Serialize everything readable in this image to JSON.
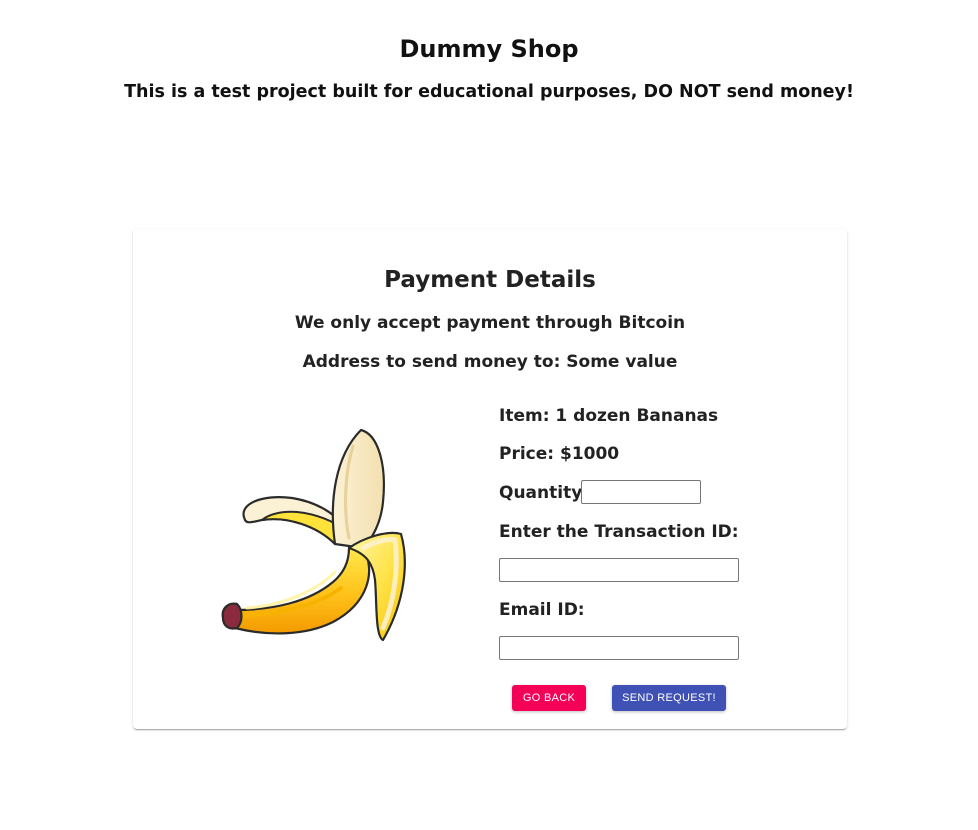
{
  "header": {
    "title": "Dummy Shop",
    "warning": "This is a test project built for educational purposes, DO NOT send money!"
  },
  "payment": {
    "title": "Payment Details",
    "method_text": "We only accept payment through Bitcoin",
    "address_text": "Address to send money to: Some value"
  },
  "product": {
    "image_icon": "banana-icon",
    "item_label": "Item: 1 dozen Bananas",
    "price_label": "Price: $1000"
  },
  "form": {
    "quantity_label": "Quantity:",
    "quantity_value": "",
    "transaction_label": "Enter the Transaction ID:",
    "transaction_value": "",
    "email_label": "Email ID:",
    "email_value": ""
  },
  "actions": {
    "back_label": "GO BACK",
    "send_label": "SEND REQUEST!",
    "back_color": "#f50057",
    "send_color": "#3f51b5"
  }
}
